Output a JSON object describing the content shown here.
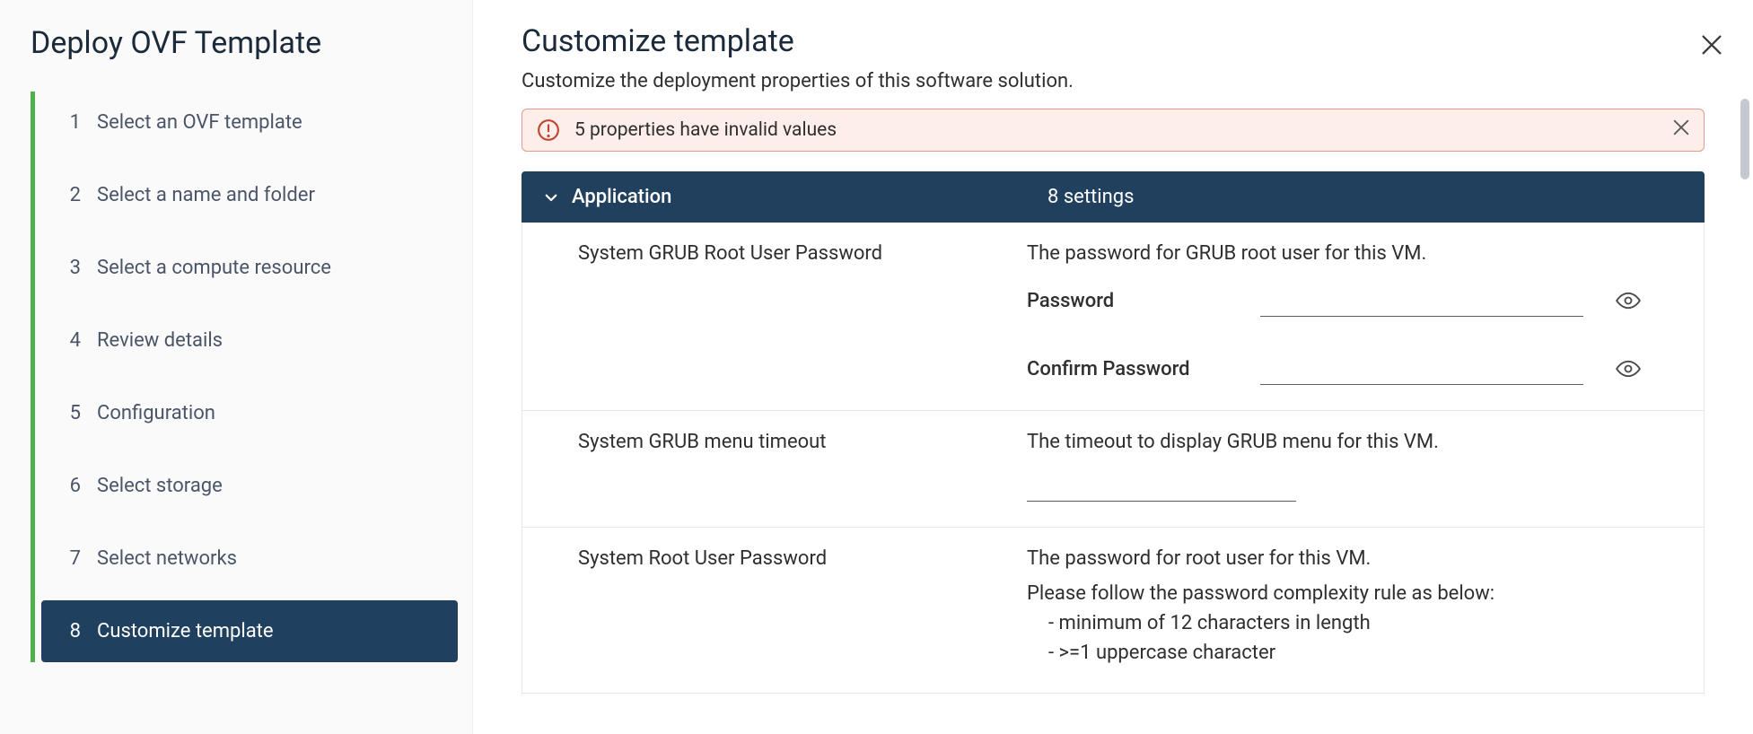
{
  "wizard": {
    "title": "Deploy OVF Template",
    "steps": [
      {
        "num": "1",
        "label": "Select an OVF template"
      },
      {
        "num": "2",
        "label": "Select a name and folder"
      },
      {
        "num": "3",
        "label": "Select a compute resource"
      },
      {
        "num": "4",
        "label": "Review details"
      },
      {
        "num": "5",
        "label": "Configuration"
      },
      {
        "num": "6",
        "label": "Select storage"
      },
      {
        "num": "7",
        "label": "Select networks"
      },
      {
        "num": "8",
        "label": "Customize template"
      }
    ],
    "active_index": 7
  },
  "panel": {
    "title": "Customize template",
    "description": "Customize the deployment properties of this software solution."
  },
  "alert": {
    "text": "5 properties have invalid values"
  },
  "section": {
    "name": "Application",
    "summary": "8 settings"
  },
  "settings": {
    "grub_root_pw": {
      "label": "System GRUB Root User Password",
      "description": "The password for GRUB root user for this VM.",
      "password_label": "Password",
      "confirm_label": "Confirm Password"
    },
    "grub_timeout": {
      "label": "System GRUB menu timeout",
      "description": "The timeout to display GRUB menu for this VM."
    },
    "root_pw": {
      "label": "System Root User Password",
      "description": "The password for root user for this VM.",
      "rule_intro": "Please follow the password complexity rule as below:",
      "rule1": "- minimum of 12 characters in length",
      "rule2": "- >=1 uppercase character"
    }
  }
}
